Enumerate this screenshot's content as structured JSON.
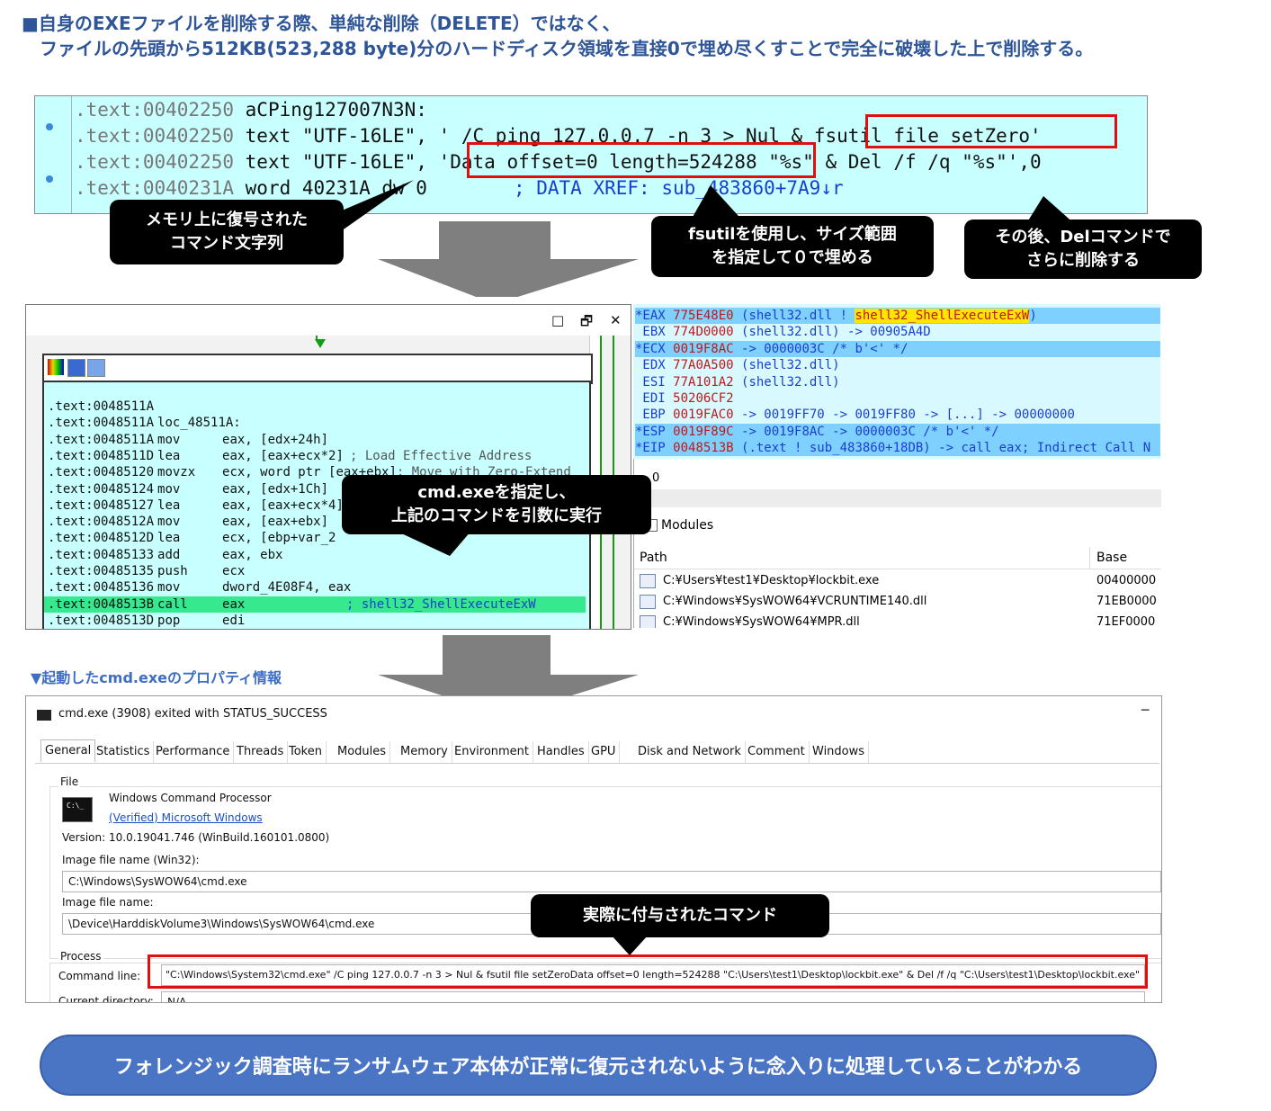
{
  "heading": {
    "line1": "■自身のEXEファイルを削除する際、単純な削除（DELETE）ではなく、",
    "line2": "　ファイルの先頭から512KB(523,288 byte)分のハードディスク領域を直接0で埋め尽くすことで完全に破壊した上で削除する。"
  },
  "disasm_top": {
    "l1_addr": ".text:00402250",
    "l1_label": " aCPing127007N3N:",
    "l2_addr": ".text:00402250",
    "l2_text": " text \"UTF-16LE\", ' /C ping 127.0.0.7 -n 3 > Nul & ",
    "l2_fsutil": "fsutil file setZero'",
    "l3_addr": ".text:00402250",
    "l3_text": " text \"UTF-16LE\", ",
    "l3_data": "'Data offset=0 length=524288",
    "l3_rest": " \"%s\" & Del /f /q \"%s\"',0",
    "l4_addr": ".text:0040231A",
    "l4_text": " word 40231A dw 0",
    "l4_xref": "; DATA XREF: sub_483860+7A9↓r"
  },
  "callouts": {
    "memory": "メモリ上に復号された\nコマンド文字列",
    "fsutil": "fsutilを使用し、サイズ範囲\nを指定して０で埋める",
    "del": "その後、Delコマンドで\nさらに削除する",
    "cmd": "cmd.exeを指定し、\n上記のコマンドを引数に実行",
    "actual": "実際に付与されたコマンド"
  },
  "ida_graph": {
    "window_buttons": [
      "□",
      "🗗",
      "✕"
    ],
    "lines": [
      {
        "a": ".text:0048511A",
        "op": "",
        "arg": "",
        "c": ""
      },
      {
        "a": ".text:0048511A",
        "op": "loc_48511A:",
        "arg": "",
        "c": ""
      },
      {
        "a": ".text:0048511A",
        "op": "mov",
        "arg": "eax, [edx+24h]",
        "c": ""
      },
      {
        "a": ".text:0048511D",
        "op": "lea",
        "arg": "eax, [eax+ecx*2]",
        "c": "; Load Effective Address"
      },
      {
        "a": ".text:00485120",
        "op": "movzx",
        "arg": "ecx, word ptr [eax+ebx]",
        "c": "; Move with Zero-Extend"
      },
      {
        "a": ".text:00485124",
        "op": "mov",
        "arg": "eax, [edx+1Ch]",
        "c": ""
      },
      {
        "a": ".text:00485127",
        "op": "lea",
        "arg": "eax, [eax+ecx*4]",
        "c": ""
      },
      {
        "a": ".text:0048512A",
        "op": "mov",
        "arg": "eax, [eax+ebx]",
        "c": ""
      },
      {
        "a": ".text:0048512D",
        "op": "lea",
        "arg": "ecx, [ebp+var_2",
        "c": ""
      },
      {
        "a": ".text:00485133",
        "op": "add",
        "arg": "eax, ebx",
        "c": ""
      },
      {
        "a": ".text:00485135",
        "op": "push",
        "arg": "ecx",
        "c": ""
      },
      {
        "a": ".text:00485136",
        "op": "mov",
        "arg": "dword_4E08F4, eax",
        "c": ""
      },
      {
        "a": ".text:0048513B",
        "op": "call",
        "arg": "eax",
        "c": "; shell32_ShellExecuteExW"
      },
      {
        "a": ".text:0048513D",
        "op": "pop",
        "arg": "edi",
        "c": ""
      },
      {
        "a": ".text:0048513E",
        "op": "pop",
        "arg": "esi",
        "c": ""
      }
    ]
  },
  "registers": [
    {
      "n": "*EAX",
      "v": "775E48E0",
      "d": " (shell32.dll ! ",
      "hl": "shell32_ShellExecuteExW",
      "e": ")",
      "blue": true
    },
    {
      "n": " EBX",
      "v": "774D0000",
      "d": " (shell32.dll) -> 00905A4D",
      "hl": "",
      "e": "",
      "blue": false
    },
    {
      "n": "*ECX",
      "v": "0019F8AC",
      "d": " -> 0000003C /* b'<' */",
      "hl": "",
      "e": "",
      "blue": true
    },
    {
      "n": " EDX",
      "v": "77A0A500",
      "d": " (shell32.dll)",
      "hl": "",
      "e": "",
      "blue": false
    },
    {
      "n": " ESI",
      "v": "77A101A2",
      "d": " (shell32.dll)",
      "hl": "",
      "e": "",
      "blue": false
    },
    {
      "n": " EDI",
      "v": "50206CF2",
      "d": "",
      "hl": "",
      "e": "",
      "blue": false
    },
    {
      "n": " EBP",
      "v": "0019FAC0",
      "d": " -> 0019FF70 -> 0019FF80 -> [...] -> 00000000",
      "hl": "",
      "e": "",
      "blue": false
    },
    {
      "n": "*ESP",
      "v": "0019F89C",
      "d": " -> 0019F8AC -> 0000003C /* b'<' */",
      "hl": "",
      "e": "",
      "blue": true
    },
    {
      "n": "*EIP",
      "v": "0048513B",
      "d": " (.text ! sub_483860+18DB) -> call eax; Indirect Call N",
      "hl": "",
      "e": "",
      "blue": true
    }
  ],
  "modules": {
    "zero": "0",
    "title": "Modules",
    "col_path": "Path",
    "col_base": "Base",
    "rows": [
      {
        "path": "C:¥Users¥test1¥Desktop¥lockbit.exe",
        "base": "00400000"
      },
      {
        "path": "C:¥Windows¥SysWOW64¥VCRUNTIME140.dll",
        "base": "71EB0000"
      },
      {
        "path": "C:¥Windows¥SysWOW64¥MPR.dll",
        "base": "71EF0000"
      }
    ]
  },
  "section_label": "▼起動したcmd.exeのプロパティ情報",
  "proc": {
    "title": "cmd.exe (3908) exited with STATUS_SUCCESS",
    "minimize": "─",
    "tabs": [
      "General",
      "Statistics",
      "Performance",
      "Threads",
      "Token",
      "Modules",
      "Memory",
      "Environment",
      "Handles",
      "GPU",
      "Disk and Network",
      "Comment",
      "Windows"
    ],
    "file_group": "File",
    "product": "Windows Command Processor",
    "verified": "(Verified) Microsoft Windows",
    "version": "Version:  10.0.19041.746 (WinBuild.160101.0800)",
    "img_win32_label": "Image file name (Win32):",
    "img_win32": "C:\\Windows\\SysWOW64\\cmd.exe",
    "img_label": "Image file name:",
    "img": "\\Device\\HarddiskVolume3\\Windows\\SysWOW64\\cmd.exe",
    "process_group": "Process",
    "cmdline_label": "Command line:",
    "cmdline": "\"C:\\Windows\\System32\\cmd.exe\"  /C ping 127.0.0.7 -n 3 > Nul & fsutil file setZeroData offset=0 length=524288 \"C:\\Users\\test1\\Desktop\\lockbit.exe\" & Del /f /q \"C:\\Users\\test1\\Desktop\\lockbit.exe\"",
    "curdir_label": "Current directory:",
    "curdir": "N/A"
  },
  "conclusion": "フォレンジック調査時にランサムウェア本体が正常に復元されないように念入りに処理していることがわかる"
}
